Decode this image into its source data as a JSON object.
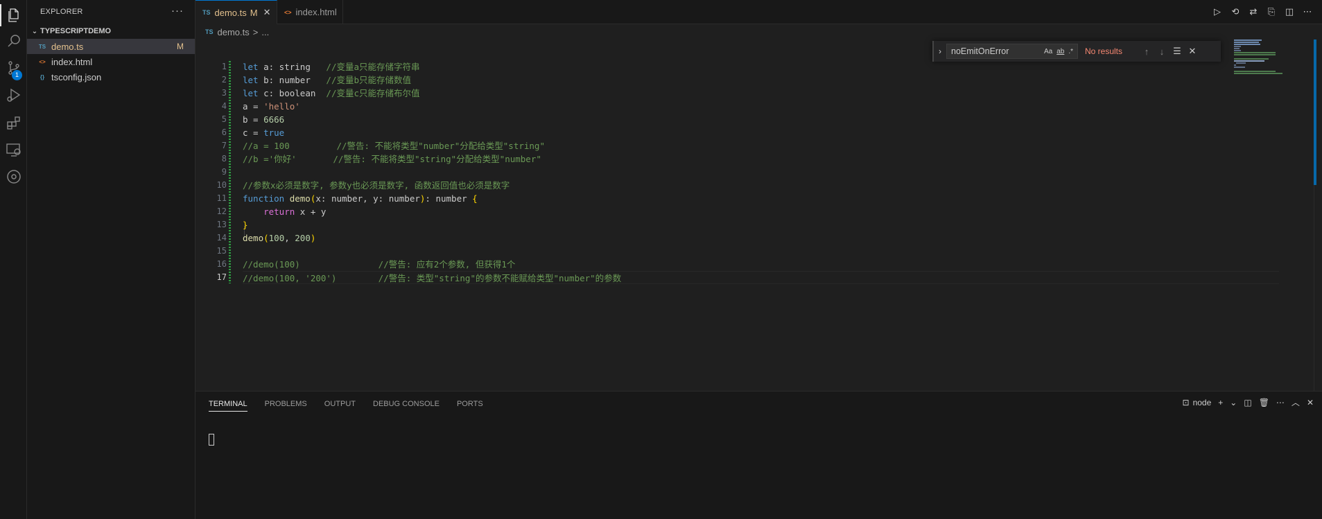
{
  "activity_bar": {
    "items": [
      {
        "name": "explorer",
        "icon": "files-icon",
        "active": true
      },
      {
        "name": "search",
        "icon": "search-icon"
      },
      {
        "name": "source-control",
        "icon": "source-control-icon",
        "badge": "1"
      },
      {
        "name": "run-debug",
        "icon": "run-debug-icon"
      },
      {
        "name": "extensions",
        "icon": "extensions-icon"
      },
      {
        "name": "remote-explorer",
        "icon": "remote-explorer-icon"
      },
      {
        "name": "gitlens",
        "icon": "gitlens-icon"
      }
    ]
  },
  "sidebar": {
    "title": "EXPLORER",
    "more": "···",
    "section": "TYPESCRIPTDEMO",
    "files": [
      {
        "icon_text": "TS",
        "icon_color": "#519aba",
        "name": "demo.ts",
        "status": "M",
        "selected": true
      },
      {
        "icon_text": "<>",
        "icon_color": "#e37933",
        "name": "index.html",
        "status": ""
      },
      {
        "icon_text": "{}",
        "icon_color": "#519aba",
        "name": "tsconfig.json",
        "status": ""
      }
    ]
  },
  "tabs": [
    {
      "icon_text": "TS",
      "label": "demo.ts",
      "status": "M",
      "close": "✕",
      "active": true
    },
    {
      "icon_text": "<>",
      "label": "index.html",
      "active": false
    }
  ],
  "breadcrumb": {
    "icon_text": "TS",
    "file": "demo.ts",
    "sep": ">",
    "rest": "..."
  },
  "editor": {
    "line_numbers": [
      "1",
      "2",
      "3",
      "4",
      "5",
      "6",
      "7",
      "8",
      "9",
      "10",
      "11",
      "12",
      "13",
      "14",
      "15",
      "16",
      "17"
    ],
    "current_line": 17,
    "lines": [
      [
        [
          "kw",
          "let "
        ],
        [
          "ty",
          "a: string   "
        ],
        [
          "cm",
          "//变量a只能存储字符串"
        ]
      ],
      [
        [
          "kw",
          "let "
        ],
        [
          "ty",
          "b: number   "
        ],
        [
          "cm",
          "//变量b只能存储数值"
        ]
      ],
      [
        [
          "kw",
          "let "
        ],
        [
          "ty",
          "c: boolean  "
        ],
        [
          "cm",
          "//变量c只能存储布尔值"
        ]
      ],
      [
        [
          "ty",
          "a = "
        ],
        [
          "str",
          "'hello'"
        ]
      ],
      [
        [
          "ty",
          "b = "
        ],
        [
          "num",
          "6666"
        ]
      ],
      [
        [
          "ty",
          "c = "
        ],
        [
          "kw",
          "true"
        ]
      ],
      [
        [
          "cm",
          "//a = 100         //警告: 不能将类型\"number\"分配给类型\"string\""
        ]
      ],
      [
        [
          "cm",
          "//b ='你好'       //警告: 不能将类型\"string\"分配给类型\"number\""
        ]
      ],
      [],
      [
        [
          "cm",
          "//参数x必须是数字, 参数y也必须是数字, 函数返回值也必须是数字"
        ]
      ],
      [
        [
          "kw",
          "function "
        ],
        [
          "fn",
          "demo"
        ],
        [
          "br1",
          "("
        ],
        [
          "ty",
          "x: number, y: number"
        ],
        [
          "br1",
          ")"
        ],
        [
          "ty",
          ": number "
        ],
        [
          "br1",
          "{"
        ]
      ],
      [
        [
          "ty",
          "    "
        ],
        [
          "br2",
          "return"
        ],
        [
          "ty",
          " x + y"
        ]
      ],
      [
        [
          "br1",
          "}"
        ]
      ],
      [
        [
          "fn",
          "demo"
        ],
        [
          "br1",
          "("
        ],
        [
          "num",
          "100"
        ],
        [
          "ty",
          ", "
        ],
        [
          "num",
          "200"
        ],
        [
          "br1",
          ")"
        ]
      ],
      [],
      [
        [
          "cm",
          "//demo(100)               //警告: 应有2个参数, 但获得1个"
        ]
      ],
      [
        [
          "cm",
          "//demo(100, '200')        //警告: 类型\"string\"的参数不能赋给类型\"number\"的参数"
        ]
      ]
    ]
  },
  "find_widget": {
    "query": "noEmitOnError",
    "match_case": "Aa",
    "whole_word": "ab",
    "regex": ".*",
    "result": "No results"
  },
  "panel": {
    "tabs": [
      "TERMINAL",
      "PROBLEMS",
      "OUTPUT",
      "DEBUG CONSOLE",
      "PORTS"
    ],
    "active_tab": "TERMINAL",
    "terminal_name": "node"
  },
  "colors": {
    "accent": "#0078d4",
    "modified": "#e2c08d",
    "keyword": "#569cd6",
    "comment": "#6a9955",
    "string": "#ce9178",
    "number": "#b5cea8",
    "function": "#dcdcaa",
    "error": "#f48771"
  }
}
